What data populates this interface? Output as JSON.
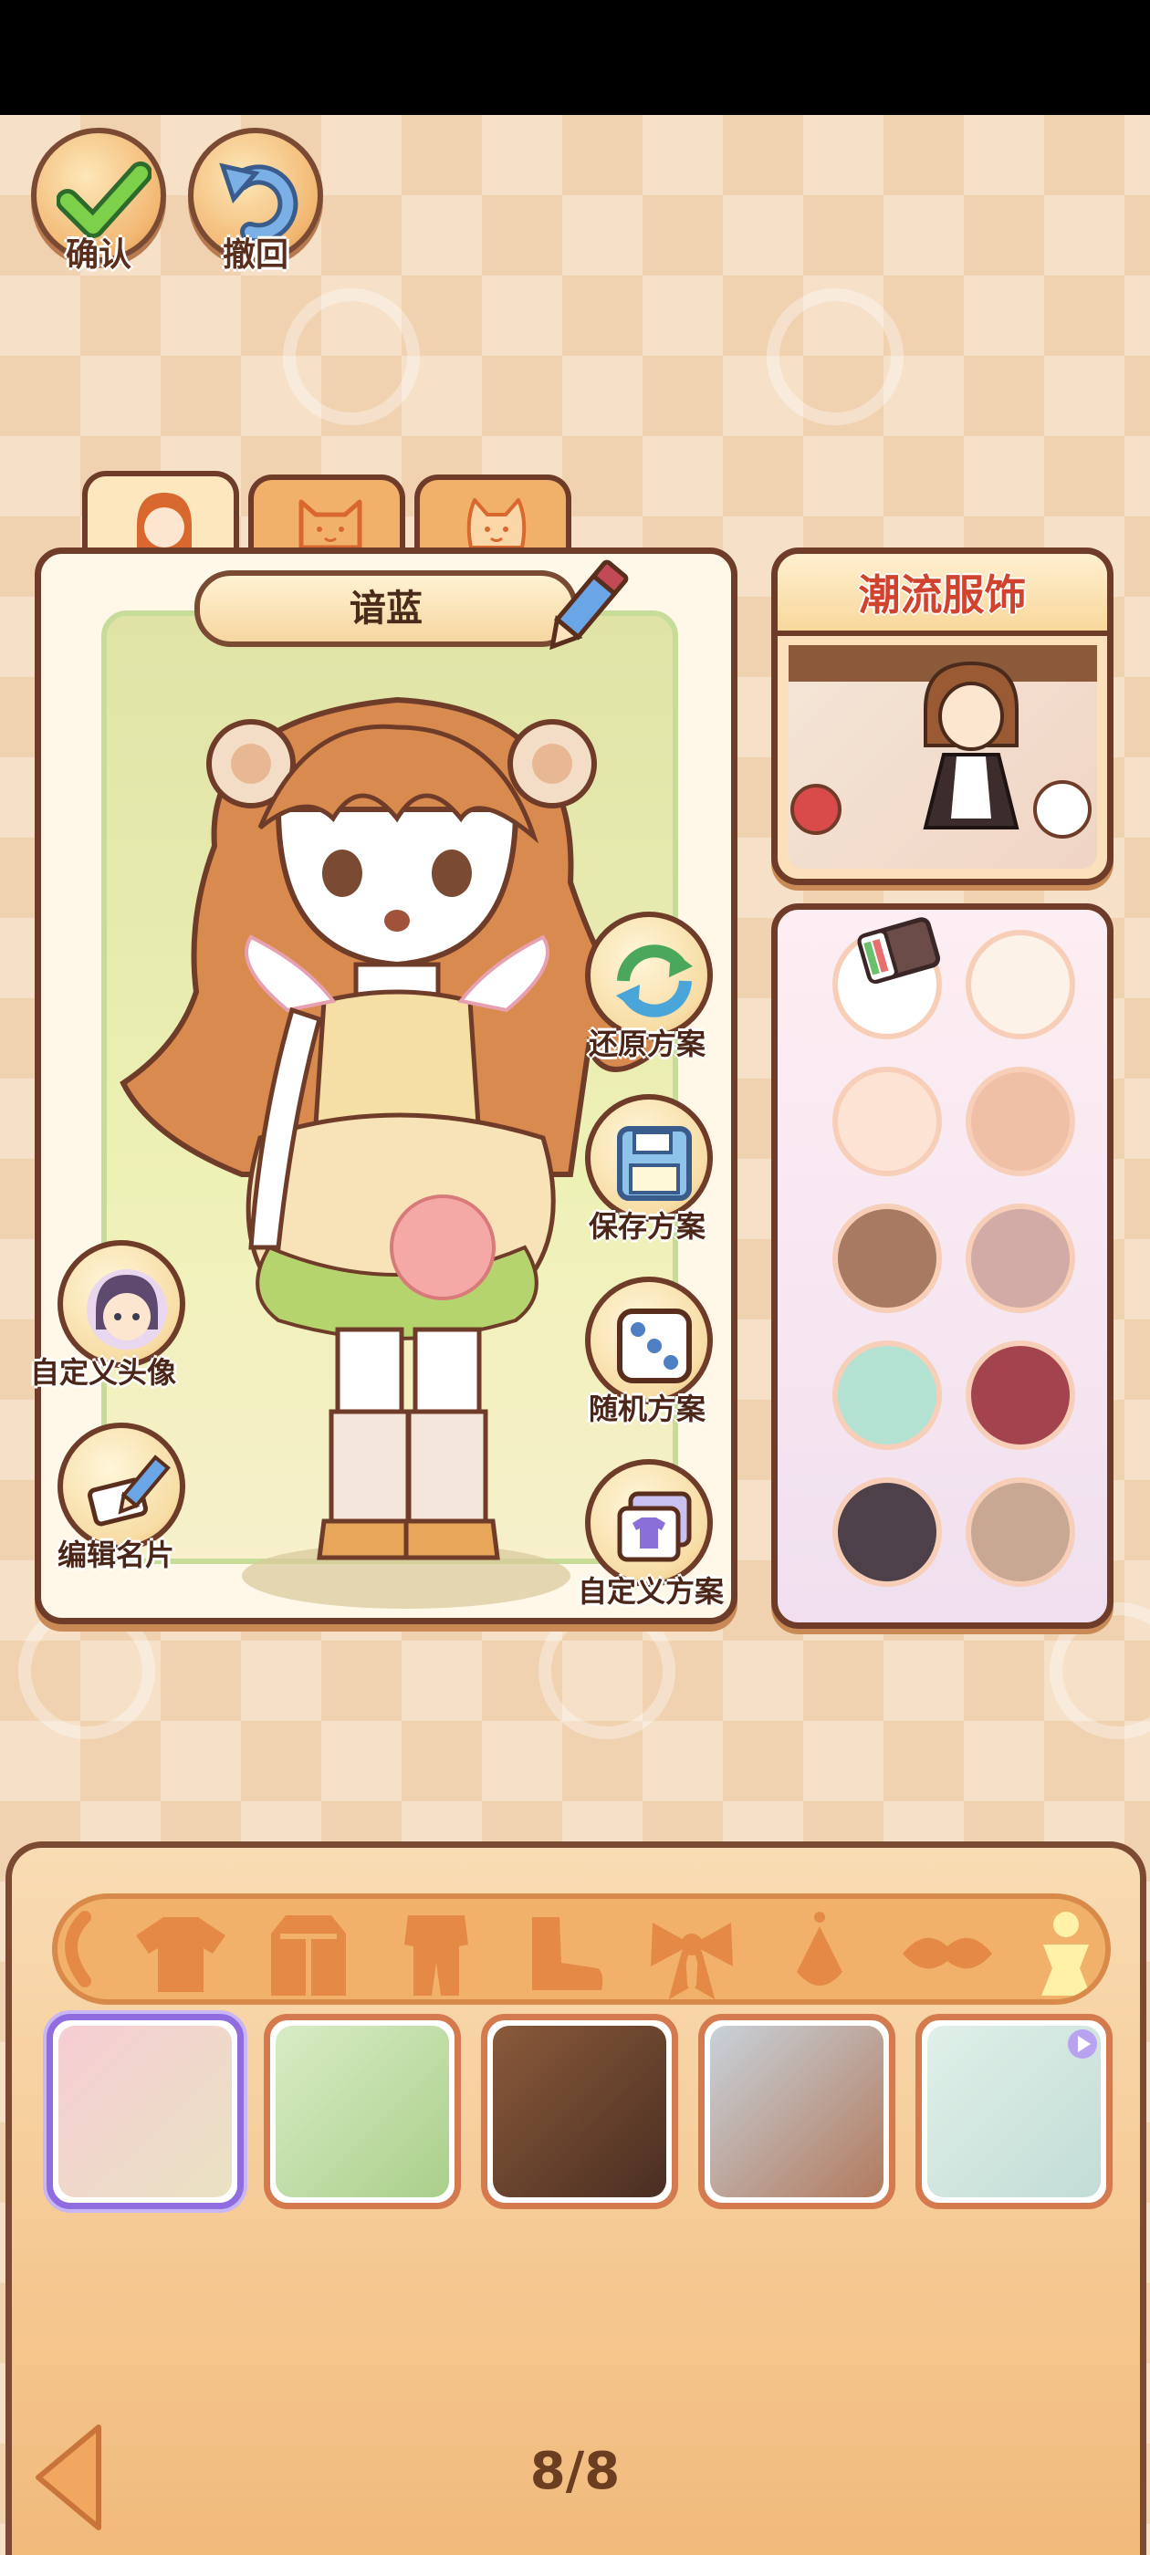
{
  "top_buttons": {
    "confirm_label": "确认",
    "undo_label": "撤回"
  },
  "character": {
    "name": "谙蓝",
    "tabs": [
      "girl-face-icon",
      "cat-face-icon",
      "cat-face-icon"
    ]
  },
  "side_actions": {
    "restore": "还原方案",
    "save": "保存方案",
    "random": "随机方案",
    "custom_plan": "自定义方案",
    "custom_avatar": "自定义头像",
    "edit_card": "编辑名片"
  },
  "fashion_card": {
    "title": "潮流服饰"
  },
  "palette": {
    "colors": [
      "#ffffff",
      "#fdf2e8",
      "#fde3d4",
      "#f0c0a6",
      "#a87a62",
      "#d2aaa6",
      "#b4e2d2",
      "#a3434e",
      "#4e4048",
      "#c8a892"
    ]
  },
  "drawer": {
    "categories": [
      "hair-icon",
      "top-icon",
      "coat-icon",
      "outfit-icon",
      "shoes-icon",
      "bow-icon",
      "earring-icon",
      "mask-icon",
      "pose-icon"
    ],
    "outfits": [
      "outfit-1",
      "outfit-2",
      "outfit-3",
      "outfit-4",
      "outfit-5"
    ],
    "page": "8/8"
  },
  "colors": {
    "brand_brown": "#6e3c28",
    "accent_orange": "#f2b16a",
    "title_red": "#d0432e",
    "active_purple": "#8f6de0"
  }
}
